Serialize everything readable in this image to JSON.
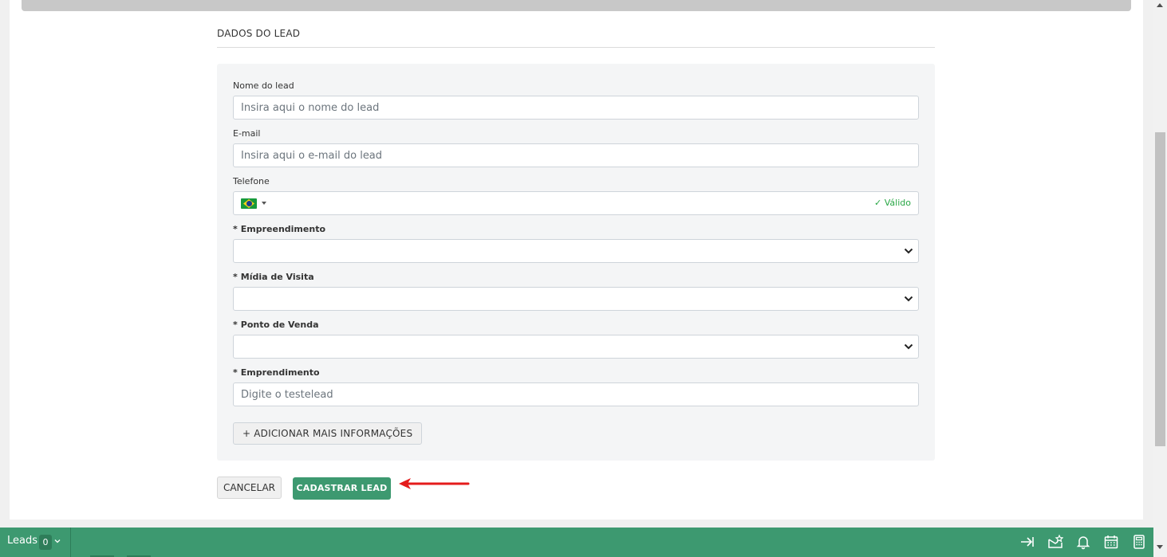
{
  "section": {
    "title": "DADOS DO LEAD"
  },
  "form": {
    "name_label": "Nome do lead",
    "name_placeholder": "Insira aqui o nome do lead",
    "email_label": "E-mail",
    "email_placeholder": "Insira aqui o e-mail do lead",
    "phone_label": "Telefone",
    "phone_valid": "✓ Válido",
    "phone_country_icon": "brazil-flag-icon",
    "empreendimento_label": "Empreendimento",
    "midia_label": "Mídia de Visita",
    "ponto_label": "Ponto de Venda",
    "emprendimento_label": "Emprendimento",
    "emprendimento_placeholder": "Digite o testelead",
    "required_mark": "*",
    "add_more_label": "+ ADICIONAR MAIS INFORMAÇÕES"
  },
  "actions": {
    "cancel_label": "CANCELAR",
    "submit_label": "CADASTRAR LEAD"
  },
  "bottom_bar": {
    "label": "Leads",
    "count": "0",
    "icons": [
      "collapse-right-icon",
      "mail-star-icon",
      "bell-icon",
      "calendar-icon",
      "calculator-icon"
    ]
  },
  "colors": {
    "accent": "#3d9970",
    "annotation_arrow": "#e41c1c",
    "valid": "#28a745"
  }
}
